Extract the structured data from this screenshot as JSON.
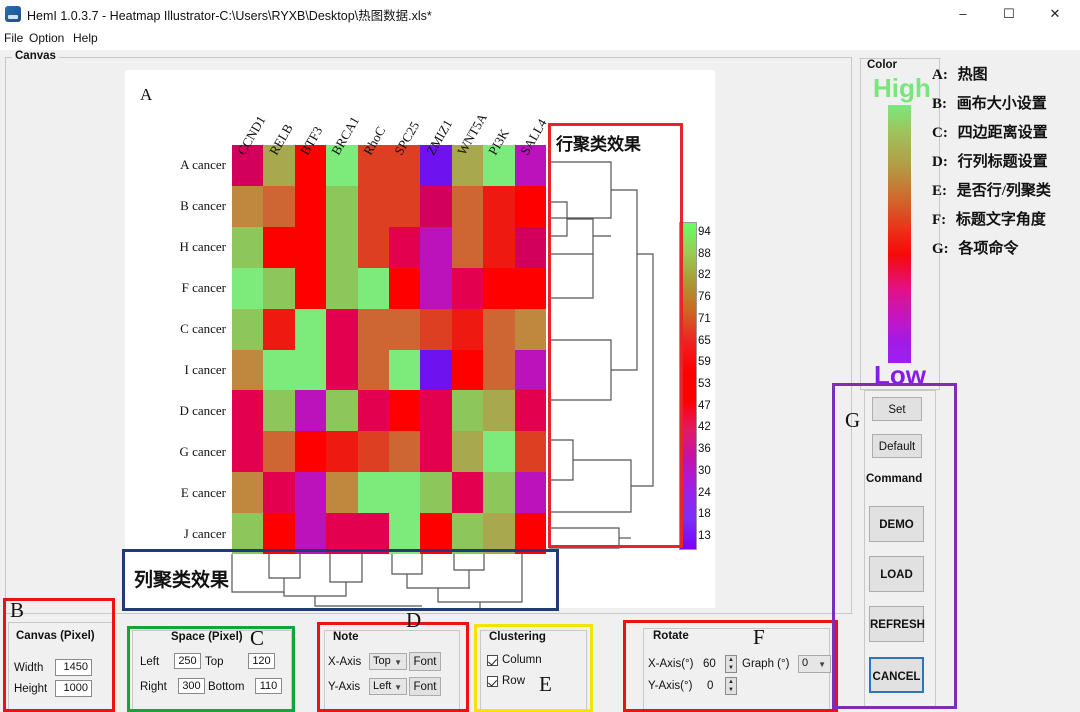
{
  "window": {
    "title": "HemI 1.0.3.7 - Heatmap Illustrator-C:\\Users\\RYXB\\Desktop\\热图数据.xls*",
    "minimize": "–",
    "maximize": "☐",
    "close": "✕"
  },
  "menu": {
    "file": "File",
    "option": "Option",
    "help": "Help"
  },
  "canvas_group": {
    "legend": "Canvas",
    "letter_a": "A"
  },
  "chart_data": {
    "type": "heatmap",
    "title": "",
    "xlabel": "",
    "ylabel": "",
    "categories_x": [
      "CCND1",
      "RELB",
      "BTF3",
      "BRCA1",
      "RhoC",
      "SPC25",
      "ZMIZ1",
      "WNT5A",
      "PI3K",
      "SALL4"
    ],
    "categories_y": [
      "A cancer",
      "B cancer",
      "H cancer",
      "F cancer",
      "C cancer",
      "I cancer",
      "D cancer",
      "G cancer",
      "E cancer",
      "J cancer"
    ],
    "colorbar": {
      "ticks": [
        94,
        88,
        82,
        76,
        71,
        65,
        59,
        53,
        47,
        42,
        36,
        30,
        24,
        18,
        13
      ],
      "high_color": "#66ff66",
      "mid_color": "#ff0000",
      "low_color": "#7a00ff"
    },
    "cell_colors": [
      [
        "#d2005c",
        "#a8a84e",
        "#ff0000",
        "#7ceb7c",
        "#dd3f22",
        "#dd3f22",
        "#6f12f0",
        "#a8a84e",
        "#7ceb7c",
        "#bb12bb"
      ],
      [
        "#c0883f",
        "#cd6633",
        "#ff0000",
        "#8dc65a",
        "#dd3f22",
        "#dd3f22",
        "#d2005c",
        "#cd6633",
        "#ee1a12",
        "#ff0000"
      ],
      [
        "#8dc65a",
        "#ff0000",
        "#ff0000",
        "#8dc65a",
        "#dd3f22",
        "#e3004f",
        "#bb12bb",
        "#cd6633",
        "#ee1a12",
        "#d2005c"
      ],
      [
        "#7ceb7c",
        "#8dc65a",
        "#ff0000",
        "#8dc65a",
        "#7ceb7c",
        "#ff0000",
        "#bb12bb",
        "#e3004f",
        "#ff0000",
        "#ff0000"
      ],
      [
        "#8dc65a",
        "#ee1a12",
        "#7ceb7c",
        "#e3004f",
        "#cd6633",
        "#cd6633",
        "#dd3f22",
        "#ee1a12",
        "#cd6633",
        "#c0883f"
      ],
      [
        "#c0883f",
        "#7ceb7c",
        "#7ceb7c",
        "#e3004f",
        "#cd6633",
        "#7ceb7c",
        "#6f12f0",
        "#ff0000",
        "#cd6633",
        "#bb12bb"
      ],
      [
        "#e3004f",
        "#8dc65a",
        "#bb12bb",
        "#8dc65a",
        "#e3004f",
        "#ff0000",
        "#e3004f",
        "#8dc65a",
        "#a8a84e",
        "#e3004f"
      ],
      [
        "#e3004f",
        "#cd6633",
        "#ff0000",
        "#ee1a12",
        "#dd3f22",
        "#cd6633",
        "#e3004f",
        "#a8a84e",
        "#7ceb7c",
        "#dd3f22"
      ],
      [
        "#c0883f",
        "#e3004f",
        "#bb12bb",
        "#c0883f",
        "#7ceb7c",
        "#7ceb7c",
        "#8dc65a",
        "#e3004f",
        "#8dc65a",
        "#bb12bb"
      ],
      [
        "#8dc65a",
        "#ff0000",
        "#bb12bb",
        "#e3004f",
        "#e3004f",
        "#7ceb7c",
        "#ff0000",
        "#8dc65a",
        "#a8a84e",
        "#ff0000"
      ]
    ]
  },
  "annotations": {
    "row_cluster_label": "行聚类效果",
    "col_cluster_label": "列聚类效果",
    "row_cluster_box_color": "#e8252a",
    "col_cluster_box_color": "#1f3c78"
  },
  "color_panel": {
    "legend": "Color",
    "high": "High",
    "low": "Low",
    "high_color": "#79e67c",
    "low_color": "#8a1ae8"
  },
  "legend_list": [
    {
      "key": "A:",
      "text": "热图"
    },
    {
      "key": "B:",
      "text": "画布大小设置"
    },
    {
      "key": "C:",
      "text": "四边距离设置"
    },
    {
      "key": "D:",
      "text": "行列标题设置"
    },
    {
      "key": "E:",
      "text": "是否行/列聚类"
    },
    {
      "key": "F:",
      "text": "标题文字角度"
    },
    {
      "key": "G:",
      "text": "各项命令"
    }
  ],
  "panels": {
    "canvas": {
      "letter": "B",
      "title": "Canvas (Pixel)",
      "width_label": "Width",
      "width_value": "1450",
      "height_label": "Height",
      "height_value": "1000",
      "box_color": "#ee1111"
    },
    "space": {
      "letter": "C",
      "title": "Space (Pixel)",
      "left_label": "Left",
      "left_value": "250",
      "top_label": "Top",
      "top_value": "120",
      "right_label": "Right",
      "right_value": "300",
      "bottom_label": "Bottom",
      "bottom_value": "110",
      "box_color": "#14a33c"
    },
    "note": {
      "letter": "D",
      "title": "Note",
      "x_label": "X-Axis",
      "x_value": "Top",
      "x_font": "Font",
      "y_label": "Y-Axis",
      "y_value": "Left",
      "y_font": "Font",
      "box_color": "#ee1111"
    },
    "clustering": {
      "letter": "E",
      "title": "Clustering",
      "column_label": "Column",
      "column_checked": true,
      "row_label": "Row",
      "row_checked": true,
      "box_color": "#f5e306"
    },
    "rotate": {
      "letter": "F",
      "title": "Rotate",
      "x_label": "X-Axis(°)",
      "x_value": "60",
      "y_label": "Y-Axis(°)",
      "y_value": "0",
      "graph_label": "Graph (°)",
      "graph_value": "0",
      "box_color": "#ee1111"
    },
    "command": {
      "letter": "G",
      "set": "Set",
      "default": "Default",
      "command_title": "Command",
      "demo": "DEMO",
      "load": "LOAD",
      "refresh": "REFRESH",
      "cancel": "CANCEL",
      "box_color": "#7b2fb5"
    }
  }
}
